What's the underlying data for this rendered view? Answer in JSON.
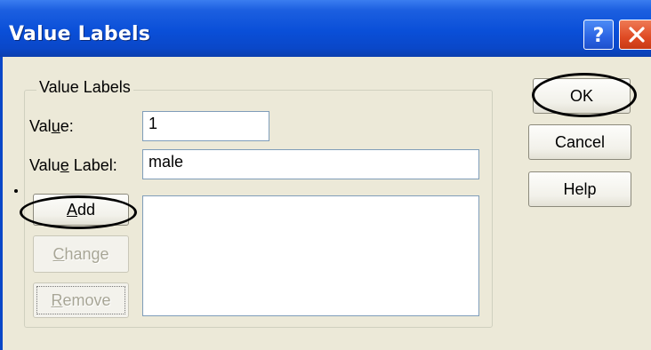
{
  "window": {
    "title": "Value Labels",
    "help_glyph": "?",
    "close_glyph": "X"
  },
  "group": {
    "caption": "Value Labels"
  },
  "value_field": {
    "label_pre": "Val",
    "label_accel": "u",
    "label_post": "e:",
    "value": "1"
  },
  "value_label_field": {
    "label_pre": "Valu",
    "label_accel": "e",
    "label_post": " Label:",
    "value": "male"
  },
  "buttons": {
    "add": {
      "accel": "A",
      "rest": "dd"
    },
    "change": {
      "accel": "C",
      "rest": "hange"
    },
    "remove": {
      "accel": "R",
      "rest": "emove"
    },
    "ok": "OK",
    "cancel": "Cancel",
    "help": "Help"
  },
  "labels_list": {
    "items": []
  },
  "colors": {
    "titlebar": "#0a47c8",
    "dialog_face": "#ece9d8",
    "close_button": "#df4a23",
    "disabled_text": "#a8a696",
    "annotation_ink": "#000000"
  }
}
